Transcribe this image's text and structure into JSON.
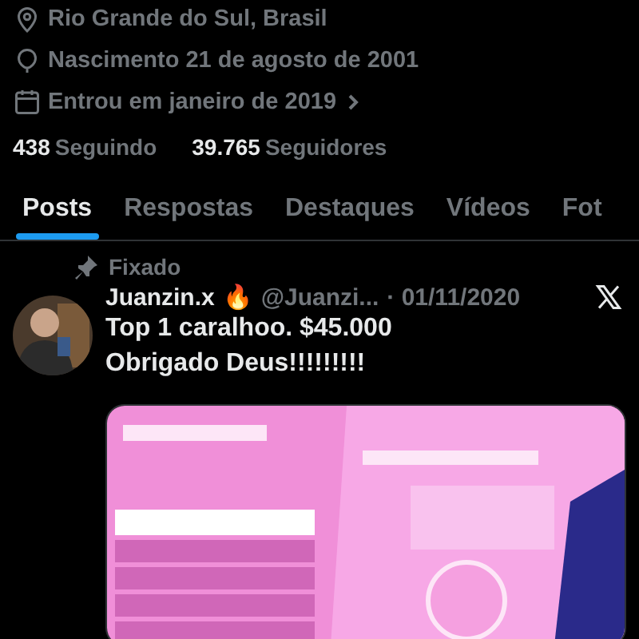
{
  "profile": {
    "details": [
      {
        "kind": "location",
        "text": "Rio Grande do Sul, Brasil",
        "chevron": false
      },
      {
        "kind": "birthday",
        "text": "Nascimento 21 de agosto de 2001",
        "chevron": false
      },
      {
        "kind": "joined",
        "text": "Entrou em janeiro de 2019",
        "chevron": true
      }
    ],
    "stats": [
      {
        "count": "438",
        "suffix": "Seguindo"
      },
      {
        "count": "39.765",
        "suffix": "Seguidores"
      }
    ]
  },
  "tabs": [
    {
      "label": "Posts",
      "selected": true
    },
    {
      "label": "Respostas",
      "selected": false
    },
    {
      "label": "Destaques",
      "selected": false
    },
    {
      "label": "Vídeos",
      "selected": false
    },
    {
      "label": "Fot",
      "selected": false
    }
  ],
  "post": {
    "pinned_label": "Fixado",
    "name": "Juanzin.x",
    "emoji": "🔥",
    "handle": "@Juanzi...",
    "date": "· 01/11/2020",
    "text_lines": [
      "Top 1 caralhoo. $45.000",
      "Obrigado Deus!!!!!!!!!"
    ],
    "media": {
      "kind": "picture"
    }
  }
}
